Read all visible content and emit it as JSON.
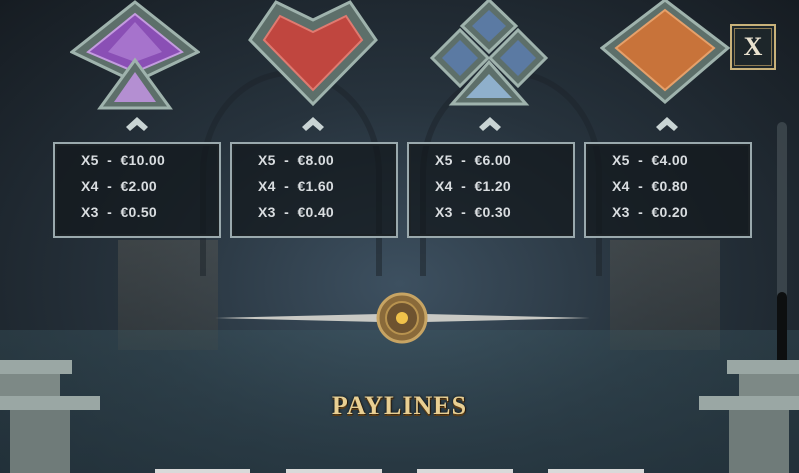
{
  "close_button": {
    "label": "X"
  },
  "paytable": [
    {
      "symbol": "purple-spade-icon",
      "color": "#8a4fb5",
      "rows": [
        {
          "mult": "X5",
          "amount": "€10.00"
        },
        {
          "mult": "X4",
          "amount": "€2.00"
        },
        {
          "mult": "X3",
          "amount": "€0.50"
        }
      ]
    },
    {
      "symbol": "red-heart-icon",
      "color": "#c0463f",
      "rows": [
        {
          "mult": "X5",
          "amount": "€8.00"
        },
        {
          "mult": "X4",
          "amount": "€1.60"
        },
        {
          "mult": "X3",
          "amount": "€0.40"
        }
      ]
    },
    {
      "symbol": "blue-club-icon",
      "color": "#5b7aa3",
      "rows": [
        {
          "mult": "X5",
          "amount": "€6.00"
        },
        {
          "mult": "X4",
          "amount": "€1.20"
        },
        {
          "mult": "X3",
          "amount": "€0.30"
        }
      ]
    },
    {
      "symbol": "orange-diamond-icon",
      "color": "#c8733a",
      "rows": [
        {
          "mult": "X5",
          "amount": "€4.00"
        },
        {
          "mult": "X4",
          "amount": "€0.80"
        },
        {
          "mult": "X3",
          "amount": "€0.20"
        }
      ]
    }
  ],
  "section_title": "PAYLINES",
  "colors": {
    "accent_gold": "#e8cf93",
    "frame": "#9aa9ad",
    "text": "#d9dde0"
  }
}
